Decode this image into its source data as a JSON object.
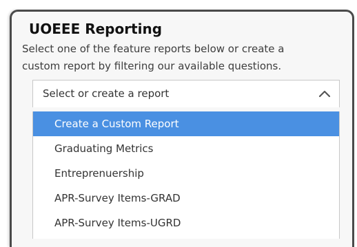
{
  "panel": {
    "title": "UOEEE Reporting",
    "description_line1": "Select one of the feature reports below or create a",
    "description_line2": "custom report by filtering our available questions."
  },
  "report_select": {
    "placeholder": "Select or create a report",
    "toggle_icon": "chevron-up-icon",
    "options": [
      {
        "label": "Create a Custom Report",
        "highlighted": true
      },
      {
        "label": "Graduating Metrics",
        "highlighted": false
      },
      {
        "label": "Entreprenuership",
        "highlighted": false
      },
      {
        "label": "APR-Survey Items-GRAD",
        "highlighted": false
      },
      {
        "label": "APR-Survey Items-UGRD",
        "highlighted": false
      }
    ]
  },
  "colors": {
    "highlight": "#4a90e2",
    "panel_border": "#4a4a4a",
    "panel_background": "#f7f7f7"
  }
}
